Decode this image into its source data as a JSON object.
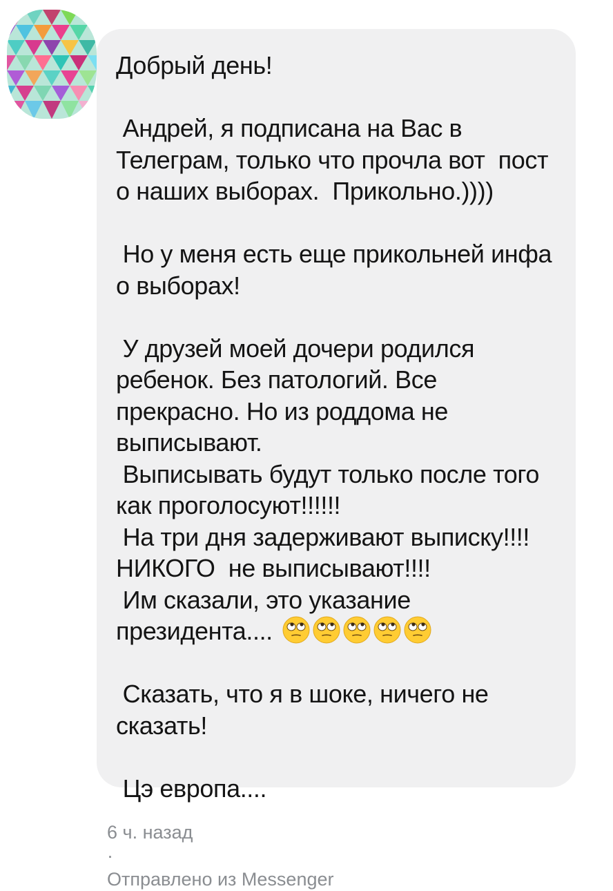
{
  "comment": {
    "lines": [
      "Добрый день!",
      "",
      " Андрей, я подписана на Вас в",
      "Телеграм, только что прочла вот  пост",
      "о наших выборах.  Прикольно.))))",
      "",
      " Но у меня есть еще прикольней инфа",
      "о выборах!",
      "",
      " У друзей моей дочери родился",
      "ребенок. Без патологий. Все",
      "прекрасно. Но из роддома не",
      "выписывают.",
      " Выписывать будут только после того",
      "как проголосуют!!!!!!",
      " На три дня задерживают выписку!!!!",
      "НИКОГО  не выписывают!!!!",
      " Им сказали, это указание",
      "президента....",
      "",
      " Сказать, что я в шоке, ничего не",
      "сказать!",
      "",
      " Цэ европа...."
    ],
    "emoji_name": "face-with-rolling-eyes",
    "emoji_count": 5,
    "colors": {
      "bubble": "#f0f0f1",
      "text": "#141414",
      "meta": "#8a8d91",
      "emoji": "#ffcc33"
    }
  },
  "footer": {
    "time": "6 ч. назад",
    "separator": "·",
    "via": "Отправлено из Messenger"
  }
}
